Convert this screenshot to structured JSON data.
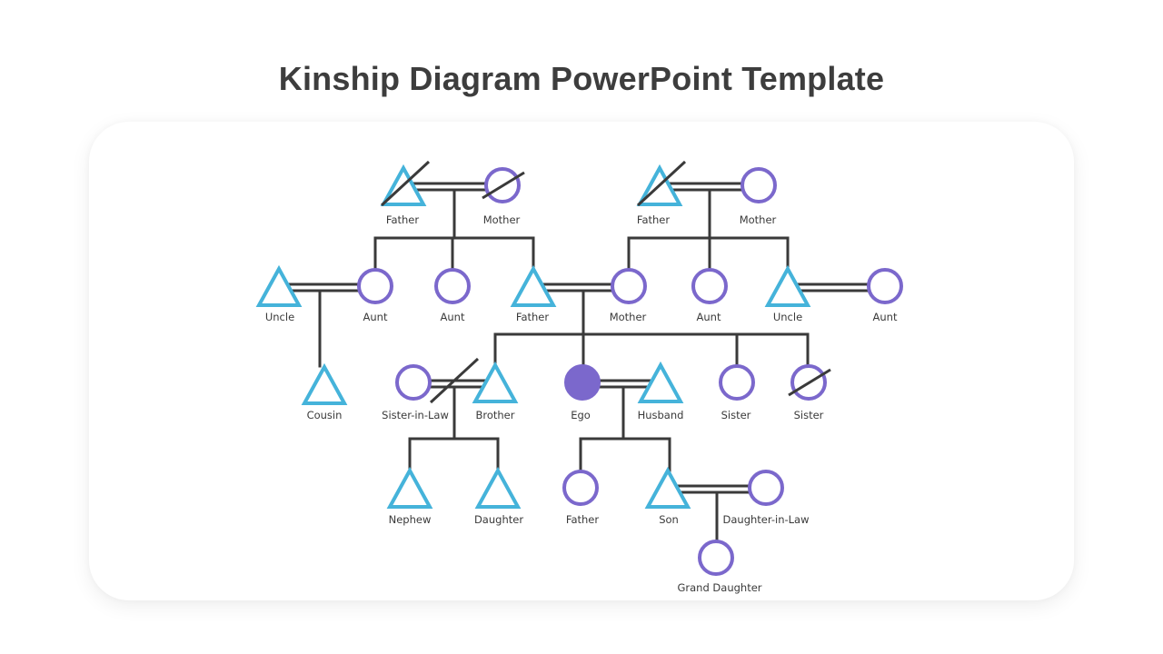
{
  "title": "Kinship Diagram PowerPoint Template",
  "colors": {
    "male": "#45b3da",
    "female": "#7b68cc",
    "ego": "#7b68cc",
    "line": "#3a3a3a",
    "title": "#3d3d3d"
  },
  "legend_symbols": {
    "triangle": "male",
    "circle": "female",
    "filled-circle": "ego",
    "diagonal-slash": "deceased",
    "double-line": "marriage"
  },
  "people": [
    {
      "id": "pgf",
      "label": "Father",
      "sex": "male",
      "deceased": true,
      "generation": 1
    },
    {
      "id": "pgm",
      "label": "Mother",
      "sex": "female",
      "deceased": true,
      "generation": 1
    },
    {
      "id": "mgf",
      "label": "Father",
      "sex": "male",
      "deceased": true,
      "generation": 1
    },
    {
      "id": "mgm",
      "label": "Mother",
      "sex": "female",
      "deceased": false,
      "generation": 1
    },
    {
      "id": "uncle1",
      "label": "Uncle",
      "sex": "male",
      "deceased": false,
      "generation": 2
    },
    {
      "id": "aunt1",
      "label": "Aunt",
      "sex": "female",
      "deceased": false,
      "generation": 2
    },
    {
      "id": "aunt2",
      "label": "Aunt",
      "sex": "female",
      "deceased": false,
      "generation": 2
    },
    {
      "id": "father",
      "label": "Father",
      "sex": "male",
      "deceased": false,
      "generation": 2
    },
    {
      "id": "mother",
      "label": "Mother",
      "sex": "female",
      "deceased": false,
      "generation": 2
    },
    {
      "id": "aunt3",
      "label": "Aunt",
      "sex": "female",
      "deceased": false,
      "generation": 2
    },
    {
      "id": "uncle2",
      "label": "Uncle",
      "sex": "male",
      "deceased": false,
      "generation": 2
    },
    {
      "id": "aunt4",
      "label": "Aunt",
      "sex": "female",
      "deceased": false,
      "generation": 2
    },
    {
      "id": "cousin",
      "label": "Cousin",
      "sex": "male",
      "deceased": false,
      "generation": 3
    },
    {
      "id": "sil",
      "label": "Sister-in-Law",
      "sex": "female",
      "deceased": false,
      "generation": 3
    },
    {
      "id": "brother",
      "label": "Brother",
      "sex": "male",
      "deceased": false,
      "generation": 3
    },
    {
      "id": "ego",
      "label": "Ego",
      "sex": "female",
      "ego": true,
      "deceased": false,
      "generation": 3
    },
    {
      "id": "husband",
      "label": "Husband",
      "sex": "male",
      "deceased": false,
      "generation": 3
    },
    {
      "id": "sister1",
      "label": "Sister",
      "sex": "female",
      "deceased": false,
      "generation": 3
    },
    {
      "id": "sister2",
      "label": "Sister",
      "sex": "female",
      "deceased": true,
      "generation": 3
    },
    {
      "id": "nephew",
      "label": "Nephew",
      "sex": "male",
      "deceased": false,
      "generation": 4
    },
    {
      "id": "niece",
      "label": "Daughter",
      "sex": "male",
      "deceased": false,
      "generation": 4
    },
    {
      "id": "child1",
      "label": "Father",
      "sex": "female",
      "deceased": false,
      "generation": 4
    },
    {
      "id": "son",
      "label": "Son",
      "sex": "male",
      "deceased": false,
      "generation": 4
    },
    {
      "id": "dil",
      "label": "Daughter-in-Law",
      "sex": "female",
      "deceased": false,
      "generation": 4
    },
    {
      "id": "gd",
      "label": "Grand Daughter",
      "sex": "female",
      "deceased": false,
      "generation": 5
    }
  ],
  "marriages": [
    {
      "a": "pgf",
      "b": "pgm",
      "divorced": false
    },
    {
      "a": "mgf",
      "b": "mgm",
      "divorced": false
    },
    {
      "a": "uncle1",
      "b": "aunt1",
      "divorced": false
    },
    {
      "a": "father",
      "b": "mother",
      "divorced": false
    },
    {
      "a": "uncle2",
      "b": "aunt4",
      "divorced": false
    },
    {
      "a": "sil",
      "b": "brother",
      "divorced": true
    },
    {
      "a": "ego",
      "b": "husband",
      "divorced": false
    },
    {
      "a": "son",
      "b": "dil",
      "divorced": false
    }
  ],
  "descent": [
    {
      "parents": [
        "pgf",
        "pgm"
      ],
      "children": [
        "aunt1",
        "aunt2",
        "father"
      ]
    },
    {
      "parents": [
        "mgf",
        "mgm"
      ],
      "children": [
        "mother",
        "aunt3",
        "uncle2"
      ]
    },
    {
      "parents": [
        "uncle1",
        "aunt1"
      ],
      "children": [
        "cousin"
      ]
    },
    {
      "parents": [
        "father",
        "mother"
      ],
      "children": [
        "brother",
        "ego",
        "sister1",
        "sister2"
      ]
    },
    {
      "parents": [
        "sil",
        "brother"
      ],
      "children": [
        "nephew",
        "niece"
      ]
    },
    {
      "parents": [
        "ego",
        "husband"
      ],
      "children": [
        "child1",
        "son"
      ]
    },
    {
      "parents": [
        "son",
        "dil"
      ],
      "children": [
        "gd"
      ]
    }
  ]
}
